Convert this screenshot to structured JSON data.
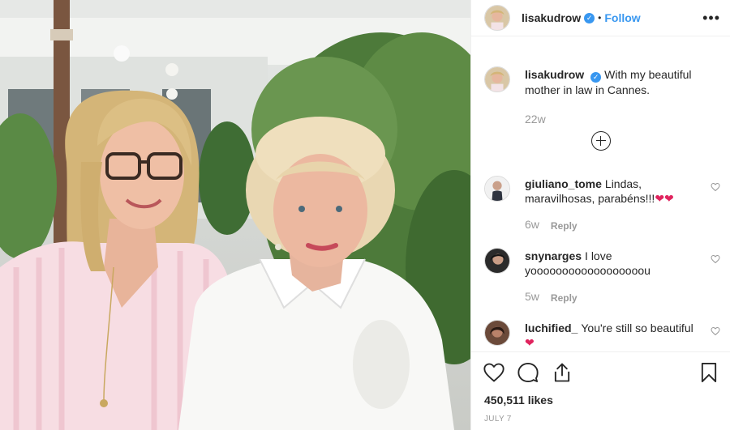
{
  "post": {
    "author": "lisakudrow",
    "follow_label": "Follow",
    "separator": "•",
    "more_label": "•••",
    "caption_text": "With my beautiful mother in law in Cannes.",
    "caption_age": "22w",
    "likes": "450,511 likes",
    "date": "JULY 7"
  },
  "comments": [
    {
      "user": "giuliano_tome",
      "text": "Lindas, maravilhosas, parabéns!!!",
      "emoji": "❤❤",
      "age": "6w",
      "reply": "Reply"
    },
    {
      "user": "snynarges",
      "text": "I love yoooooooooooooooooou",
      "emoji": "",
      "age": "5w",
      "reply": "Reply"
    },
    {
      "user": "luchified_",
      "text": "You're still so beautiful",
      "emoji": "❤",
      "age": "",
      "reply": ""
    }
  ],
  "colors": {
    "accent": "#3897f0",
    "heart": "#e0245e",
    "muted": "#999999",
    "border": "#efefef"
  },
  "icons": [
    "verified-badge-icon",
    "more-options-icon",
    "load-more-plus-icon",
    "like-heart-icon",
    "comment-icon",
    "share-icon",
    "bookmark-icon"
  ]
}
